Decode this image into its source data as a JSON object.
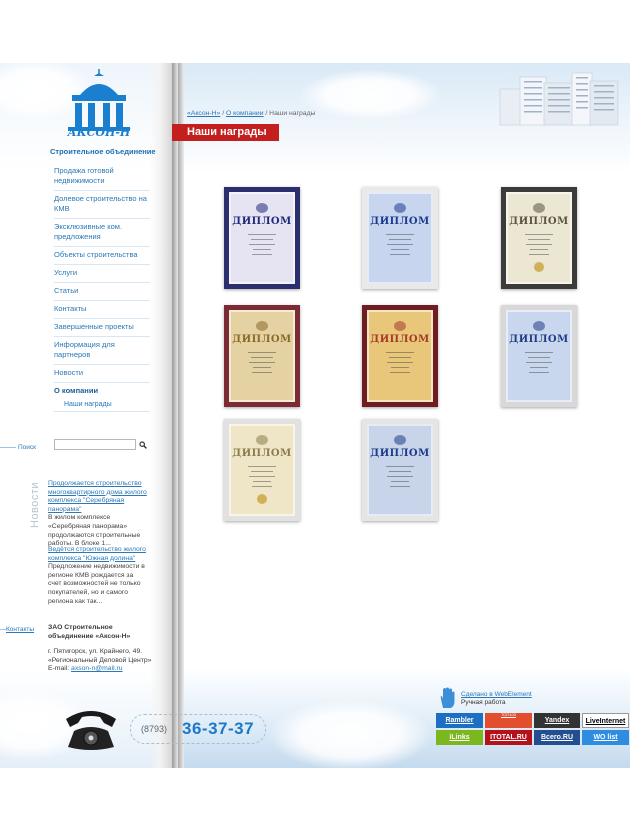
{
  "brand": {
    "logo_text": "АКСОН-Н",
    "tagline": "Строительное объединение",
    "colors": {
      "brand_blue": "#1b7fcf",
      "accent_red": "#c31f1f",
      "link_blue": "#2a78b8"
    }
  },
  "menu": {
    "items": [
      {
        "label": "Продажа готовой недвижимости"
      },
      {
        "label": "Долевое строительство на КМВ"
      },
      {
        "label": "Эксклюзивные ком. предложения"
      },
      {
        "label": "Объекты строительства"
      },
      {
        "label": "Услуги"
      },
      {
        "label": "Статьи"
      },
      {
        "label": "Контакты"
      },
      {
        "label": "Завершенные проекты"
      },
      {
        "label": "Информация для партнеров"
      },
      {
        "label": "Новости"
      },
      {
        "label": "О компании"
      }
    ],
    "sub_item": "Наши награды"
  },
  "search": {
    "label": "Поиск",
    "value": "",
    "icon": "magnifier-icon"
  },
  "news": {
    "heading": "Новости",
    "items": [
      {
        "title": "Продолжается строительство многоквартирного дома жилого комплекса \"Серебряная панорама\"",
        "text": "В жилом комплексе «Серебряная панорама» продолжаются строительные работы. В блоке 1..."
      },
      {
        "title": "Ведётся строительство жилого комплекса \"Южная долина\"",
        "text": "Предложение недвижимости в регионе КМВ рождается за счет возможностей не только покупателей, но и самого региона как так..."
      }
    ]
  },
  "contacts": {
    "link": "Контакты",
    "company_name": "ЗАО Строительное объединение «Аксон-Н»",
    "address_line1": "г. Пятигорск, ул. Крайнего, 49.",
    "address_line2": "«Региональный Деловой Центр»",
    "email_label": "E-mail:",
    "email": "axson-n@mail.ru"
  },
  "phone": {
    "code": "(8793)",
    "number": "36-37-37",
    "icon": "telephone-icon"
  },
  "breadcrumb": {
    "home": "«Аксон-Н»",
    "section": "О компании",
    "current": "Наши награды",
    "separator": "/"
  },
  "page_title": "Наши награды",
  "diplomas": [
    {
      "word": "ДИПЛОМ",
      "frame": "#2c2f6e",
      "paper": "#e6e3f3",
      "word_color": "#1f2a7a"
    },
    {
      "word": "ДИПЛОМ",
      "frame": "#e9e9e9",
      "paper": "#c7d6ee",
      "word_color": "#1b3a8f"
    },
    {
      "word": "ДИПЛОМ",
      "frame": "#3b3b3b",
      "paper": "#ece7d3",
      "word_color": "#5a5442"
    },
    {
      "word": "ДИПЛОМ",
      "frame": "#7a2b33",
      "paper": "#e4d2a2",
      "word_color": "#8a6a2a"
    },
    {
      "word": "ДИПЛОМ",
      "frame": "#6e1d22",
      "paper": "#e8c77a",
      "word_color": "#a53a2a"
    },
    {
      "word": "ДИПЛОМ",
      "frame": "#d8d8d8",
      "paper": "#c9d7ee",
      "word_color": "#223d86"
    },
    {
      "word": "ДИПЛОМ",
      "frame": "#e1e1e1",
      "paper": "#efe6c8",
      "word_color": "#8a7c4c"
    },
    {
      "word": "ДИПЛОМ",
      "frame": "#e5e5e5",
      "paper": "#c7d4ea",
      "word_color": "#1d3b8a"
    }
  ],
  "footer": {
    "webelement_link": "Сделано в WebElement",
    "webelement_sub": "Ручная работа",
    "counters": [
      {
        "label": "Rambler",
        "sub": "ТОП100",
        "color": "#1c6fc2"
      },
      {
        "label": "Yandex",
        "sub": "ЯНДЕКС",
        "color": "#333333"
      },
      {
        "label": "LiveInternet",
        "sub": "СВЕЖИЕ СТАТИСТИКИ",
        "color": "#ffffff",
        "text_color": "#000"
      },
      {
        "label": "iLinks",
        "sub": "Каталог сайтов",
        "color": "#7cb71f"
      },
      {
        "label": "ITOTAL.RU",
        "sub": "КАТАЛОГ САЙТОВ",
        "color": "#b3121b"
      },
      {
        "label": "Всего.RU",
        "sub": "каталог всего",
        "color": "#234f8f"
      },
      {
        "label": "WO list",
        "sub": "КАТАЛОГ САЙТОВ",
        "color": "#2e8de0"
      }
    ]
  }
}
